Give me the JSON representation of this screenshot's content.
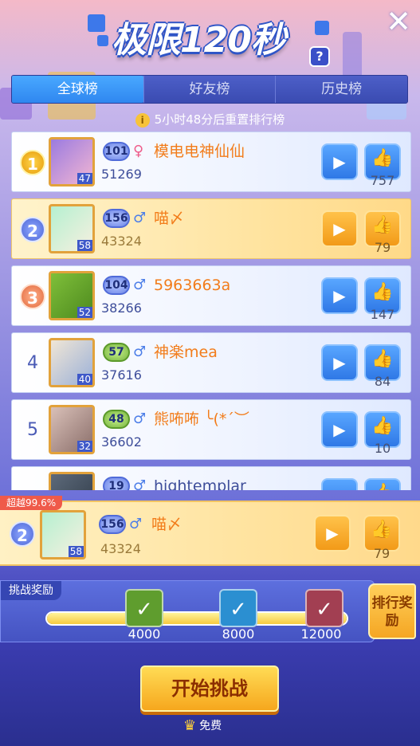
{
  "header": {
    "title": "极限120秒",
    "help_label": "?",
    "close_label": "✕"
  },
  "tabs": [
    {
      "label": "全球榜",
      "active": true
    },
    {
      "label": "好友榜",
      "active": false
    },
    {
      "label": "历史榜",
      "active": false
    }
  ],
  "reset_notice": "5小时48分后重置排行榜",
  "leaderboard": [
    {
      "rank": "1",
      "level": "47",
      "badge": "101",
      "gender": "female",
      "name": "模电电神仙仙",
      "score": "51269",
      "likes": "757",
      "highlight": false
    },
    {
      "rank": "2",
      "level": "58",
      "badge": "156",
      "gender": "male",
      "name": "喵〆",
      "score": "43324",
      "likes": "79",
      "highlight": true
    },
    {
      "rank": "3",
      "level": "52",
      "badge": "104",
      "gender": "male",
      "name": "5963663a",
      "score": "38266",
      "likes": "147",
      "highlight": false
    },
    {
      "rank": "4",
      "level": "40",
      "badge": "57",
      "gender": "male",
      "name": "神楽mea",
      "score": "37616",
      "likes": "84",
      "highlight": false
    },
    {
      "rank": "5",
      "level": "32",
      "badge": "48",
      "gender": "male",
      "name": "熊咘咘 ╰(*´︶",
      "score": "36602",
      "likes": "10",
      "highlight": false
    },
    {
      "rank": "",
      "level": "",
      "badge": "19",
      "gender": "male",
      "name": "hightemplar",
      "score": "",
      "likes": "",
      "highlight": false
    }
  ],
  "my_entry": {
    "beat_label": "超越99.6%",
    "rank": "2",
    "level": "58",
    "badge": "156",
    "name": "喵〆",
    "score": "43324",
    "likes": "79"
  },
  "challenge_reward": {
    "title": "挑战奖励",
    "progress": 1.0,
    "milestones": [
      {
        "label": "4000",
        "color": "#5f9d2e"
      },
      {
        "label": "8000",
        "color": "#2b8fd1"
      },
      {
        "label": "12000",
        "color": "#a23f52"
      }
    ]
  },
  "rank_reward_label": "排行奖励",
  "start_button": "开始挑战",
  "free_label": "免费",
  "icons": {
    "video": "video-camera-icon",
    "like": "thumbs-up-icon",
    "check": "checkmark-icon",
    "crown": "crown-icon"
  }
}
